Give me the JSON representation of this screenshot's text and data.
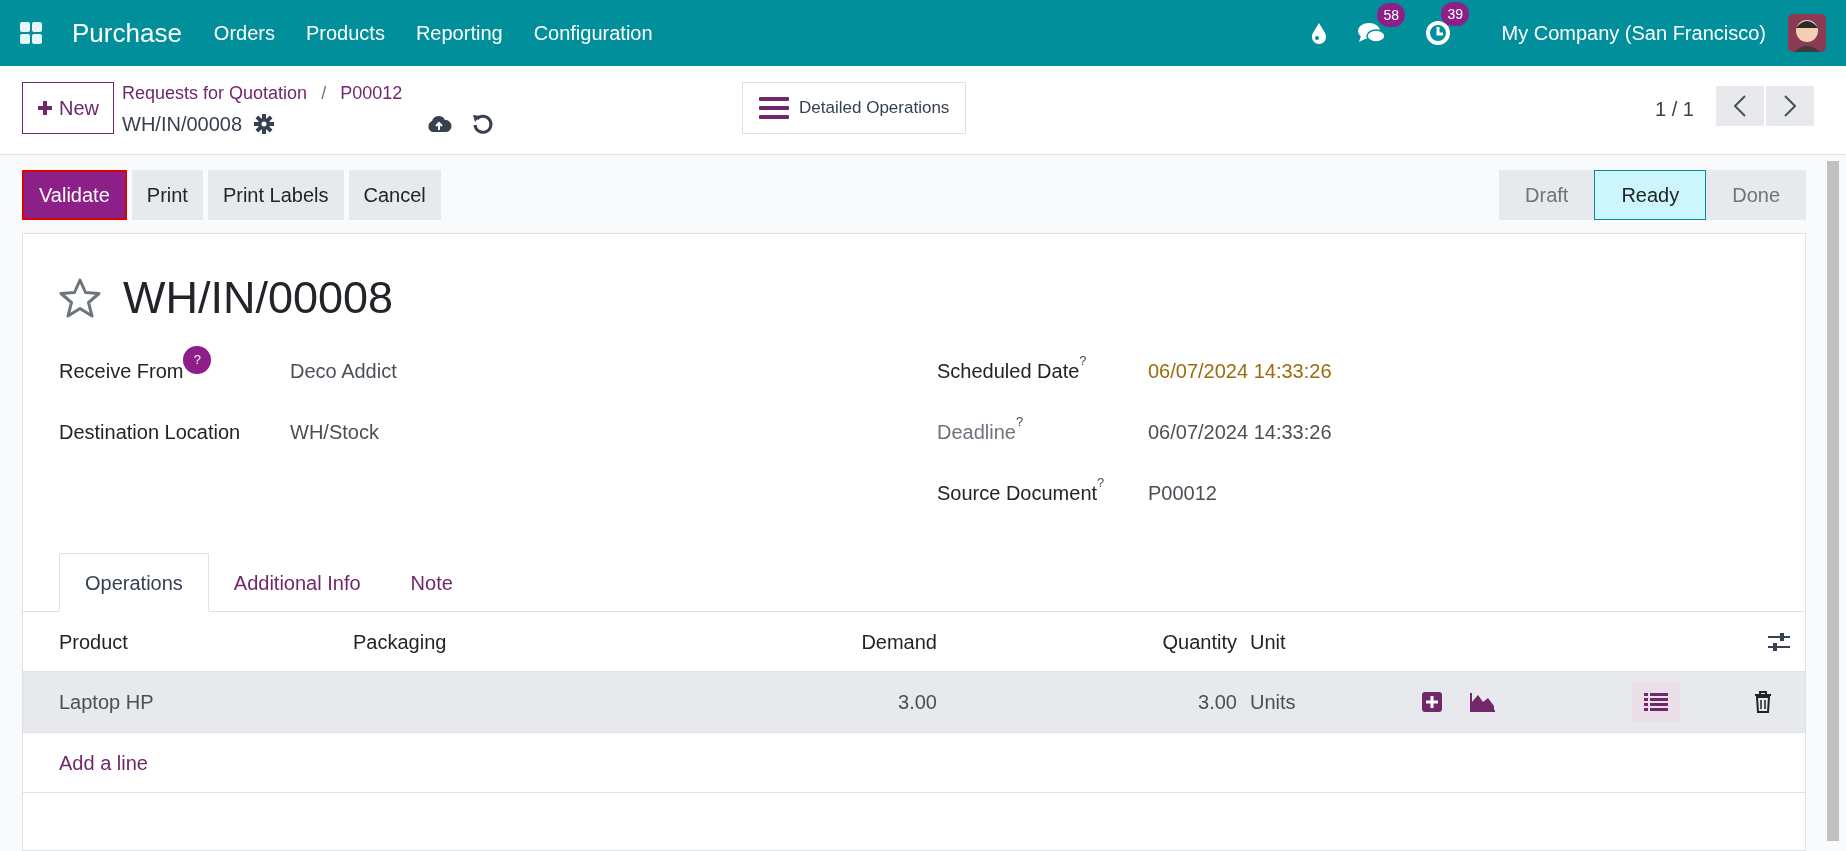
{
  "navbar": {
    "app": "Purchase",
    "menu": [
      "Orders",
      "Products",
      "Reporting",
      "Configuration"
    ],
    "messages_count": "58",
    "activities_count": "39",
    "company": "My Company (San Francisco)"
  },
  "control_panel": {
    "new_button": "New",
    "breadcrumbs": [
      "Requests for Quotation",
      "P00012"
    ],
    "breadcrumb_separator": "/",
    "record": "WH/IN/00008",
    "center_button": "Detailed Operations",
    "pager": "1 / 1"
  },
  "actions": [
    {
      "label": "Validate",
      "primary": true
    },
    {
      "label": "Print",
      "primary": false
    },
    {
      "label": "Print Labels",
      "primary": false
    },
    {
      "label": "Cancel",
      "primary": false
    }
  ],
  "statusbar": [
    {
      "label": "Draft",
      "selected": false
    },
    {
      "label": "Ready",
      "selected": true
    },
    {
      "label": "Done",
      "selected": false
    }
  ],
  "form": {
    "title": "WH/IN/00008",
    "starred": false,
    "left_fields": [
      {
        "label": "Receive From",
        "value": "Deco Addict",
        "help": "?",
        "muted": false,
        "highlight": false
      },
      {
        "label": "Destination Location",
        "value": "WH/Stock",
        "muted": false,
        "highlight": false
      }
    ],
    "right_fields": [
      {
        "label": "Scheduled Date",
        "value": "06/07/2024 14:33:26",
        "tip": "?",
        "muted": false,
        "highlight": true
      },
      {
        "label": "Deadline",
        "value": "06/07/2024 14:33:26",
        "tip": "?",
        "muted": true,
        "highlight": false
      },
      {
        "label": "Source Document",
        "value": "P00012",
        "tip": "?",
        "muted": false,
        "highlight": false
      }
    ]
  },
  "tabs": [
    {
      "label": "Operations",
      "selected": true
    },
    {
      "label": "Additional Info",
      "selected": false
    },
    {
      "label": "Note",
      "selected": false
    }
  ],
  "table": {
    "columns": [
      "Product",
      "Packaging",
      "Demand",
      "Quantity",
      "Unit"
    ],
    "rows": [
      {
        "product": "Laptop HP",
        "demand": "3.00",
        "quantity": "3.00",
        "unit": "Units"
      }
    ],
    "add_line": "Add a line"
  }
}
